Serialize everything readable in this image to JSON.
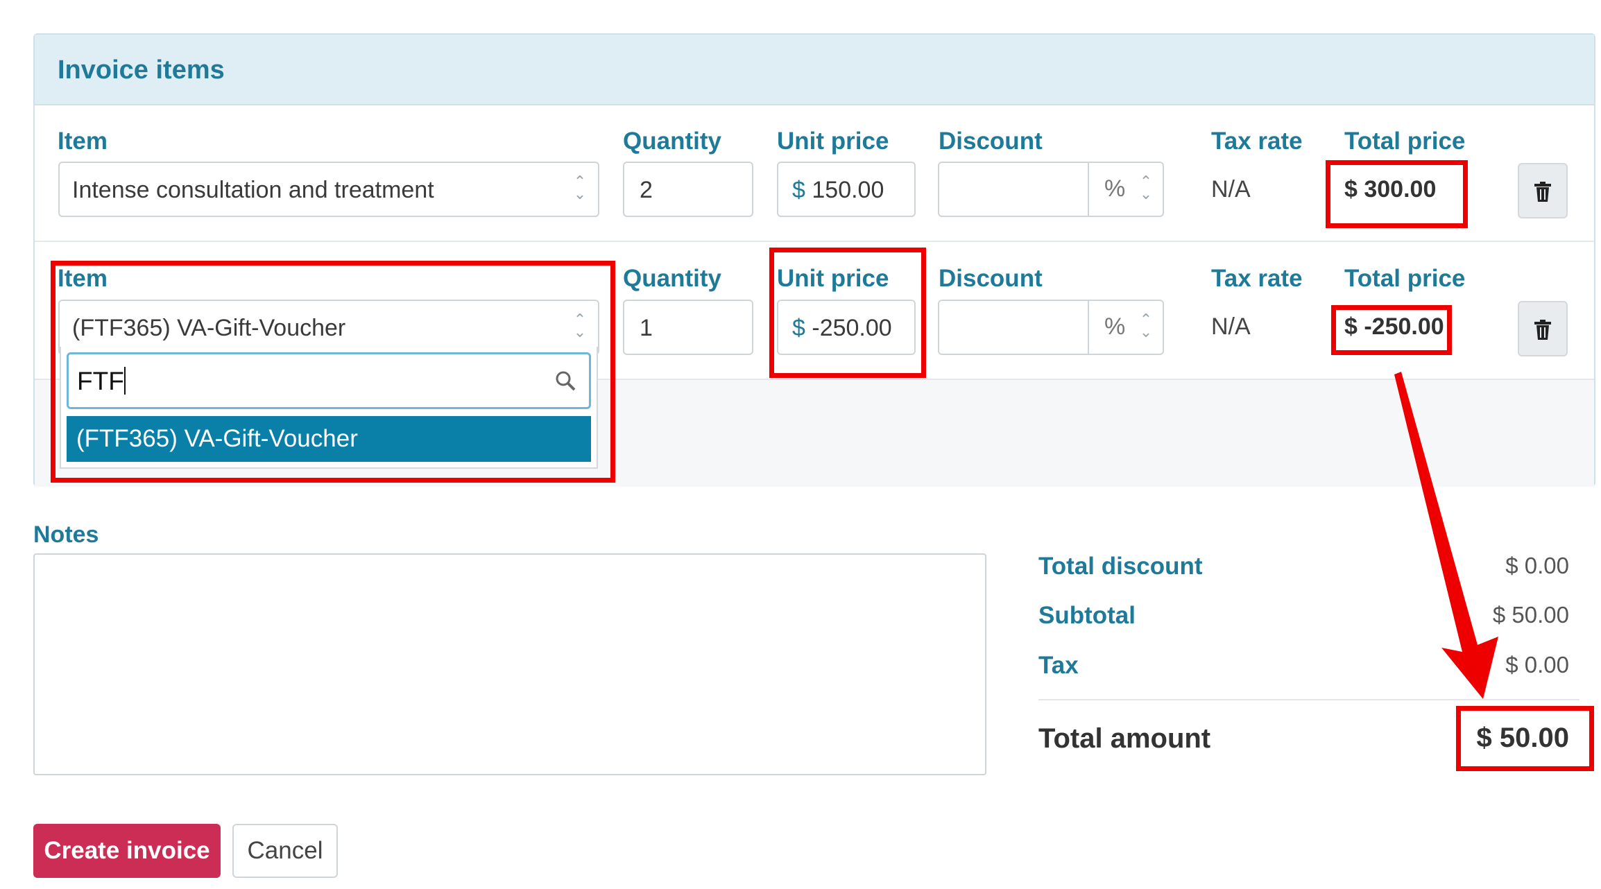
{
  "panel": {
    "title": "Invoice items"
  },
  "labels": {
    "item": "Item",
    "quantity": "Quantity",
    "unit_price": "Unit price",
    "discount": "Discount",
    "tax_rate": "Tax rate",
    "total_price": "Total price"
  },
  "rows": [
    {
      "item": "Intense consultation and treatment",
      "quantity": "2",
      "currency": "$",
      "unit_price": "150.00",
      "discount": "",
      "discount_unit": "%",
      "tax_rate": "N/A",
      "total_price": "$ 300.00"
    },
    {
      "item": "(FTF365) VA-Gift-Voucher",
      "quantity": "1",
      "currency": "$",
      "unit_price": "-250.00",
      "discount": "",
      "discount_unit": "%",
      "tax_rate": "N/A",
      "total_price": "$ -250.00"
    }
  ],
  "dropdown": {
    "search_value": "FTF",
    "options": [
      "(FTF365) VA-Gift-Voucher"
    ]
  },
  "notes": {
    "label": "Notes",
    "value": ""
  },
  "summary": {
    "total_discount_label": "Total discount",
    "total_discount": "$ 0.00",
    "subtotal_label": "Subtotal",
    "subtotal": "$ 50.00",
    "tax_label": "Tax",
    "tax": "$ 0.00",
    "total_amount_label": "Total amount",
    "total_amount": "$ 50.00"
  },
  "buttons": {
    "create": "Create invoice",
    "cancel": "Cancel"
  },
  "icons": {
    "trash": "trash-icon",
    "search": "search-icon",
    "arrow": "annotation-arrow"
  },
  "colors": {
    "accent": "#1f7a99",
    "primary_button": "#cc2d55",
    "highlight": "#ee0000",
    "selected_option": "#0a7fa7"
  }
}
